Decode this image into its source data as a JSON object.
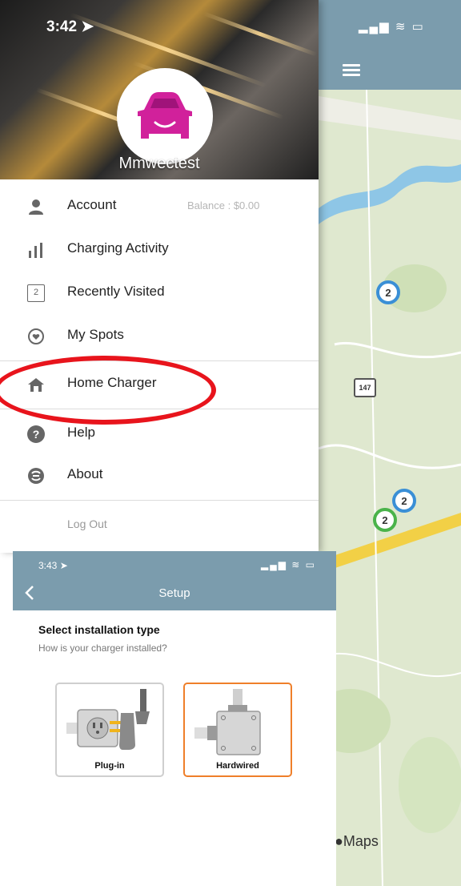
{
  "menu": {
    "time": "3:42",
    "username": "Mmwectest",
    "items": [
      {
        "label": "Account",
        "icon": "user-icon"
      },
      {
        "label": "Charging Activity",
        "icon": "bar-chart-icon"
      },
      {
        "label": "Recently Visited",
        "icon": "calendar-icon"
      },
      {
        "label": "My Spots",
        "icon": "heart-icon"
      },
      {
        "label": "Home Charger",
        "icon": "home-icon"
      },
      {
        "label": "Help",
        "icon": "help-icon"
      },
      {
        "label": "About",
        "icon": "about-icon"
      }
    ],
    "balance": "Balance : $0.00",
    "logout": "Log Out",
    "calendar_day": "2"
  },
  "map": {
    "pins": [
      "2",
      "2",
      "2"
    ],
    "route_label": "147",
    "attribution": "Maps"
  },
  "setup": {
    "time": "3:43",
    "title": "Setup",
    "heading": "Select installation type",
    "subheading": "How is your charger installed?",
    "options": [
      {
        "label": "Plug-in",
        "selected": false
      },
      {
        "label": "Hardwired",
        "selected": true
      }
    ]
  },
  "colors": {
    "header_blue": "#7b9cad",
    "highlight_red": "#e8141c",
    "selected_orange": "#ef7f2a",
    "avatar_pink": "#d1219b"
  }
}
